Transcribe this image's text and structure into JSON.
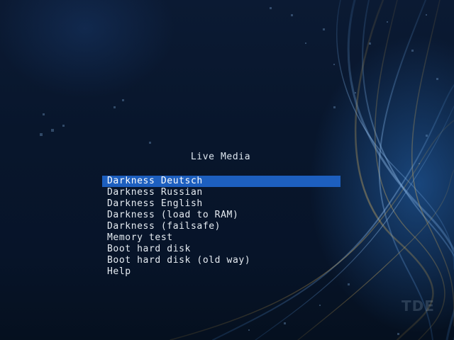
{
  "menu": {
    "title": "Live Media",
    "selected_index": 0,
    "items": [
      {
        "label": "Darkness Deutsch"
      },
      {
        "label": "Darkness Russian"
      },
      {
        "label": "Darkness English"
      },
      {
        "label": "Darkness (load to RAM)"
      },
      {
        "label": "Darkness (failsafe)"
      },
      {
        "label": "Memory test"
      },
      {
        "label": "Boot hard disk"
      },
      {
        "label": "Boot hard disk (old way)"
      },
      {
        "label": "Help"
      }
    ]
  },
  "watermark": {
    "text": "TDE"
  },
  "colors": {
    "background": "#08162c",
    "highlight": "#1d5fbf",
    "text": "#e6ecf2"
  }
}
